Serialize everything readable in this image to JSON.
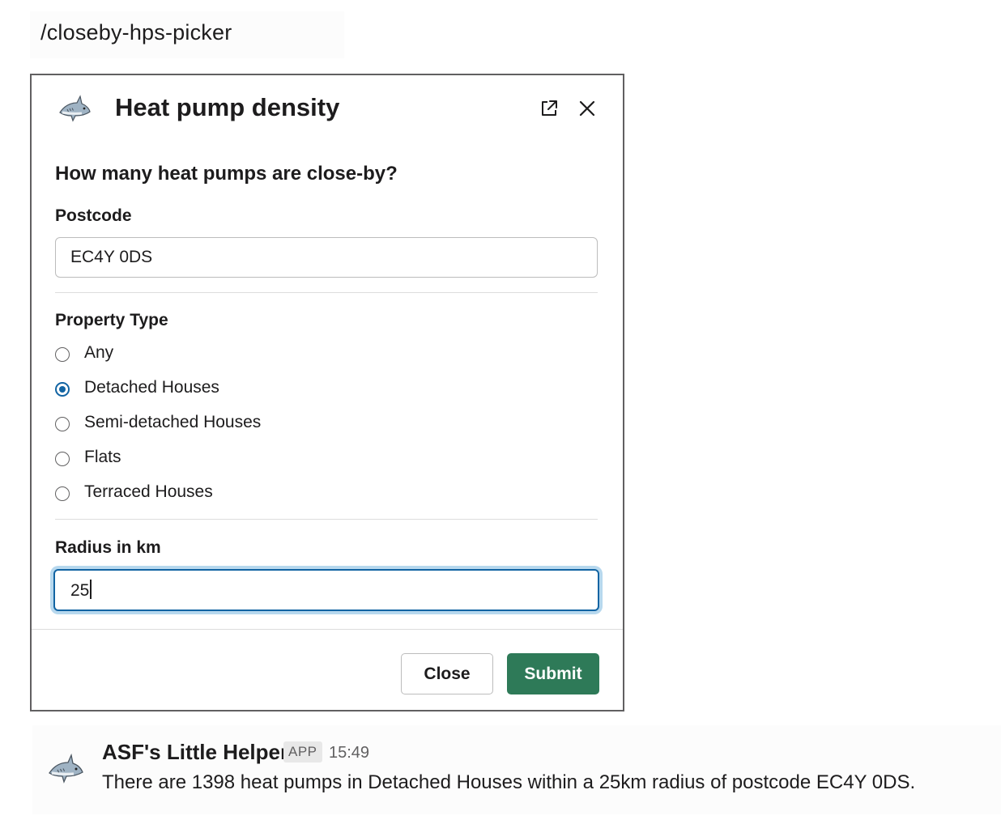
{
  "command": {
    "text": "/closeby-hps-picker"
  },
  "modal": {
    "title": "Heat pump density",
    "app_icon": "shark-icon",
    "header_icons": [
      "external-link-icon",
      "close-icon"
    ],
    "question": "How many heat pumps are close-by?",
    "postcode": {
      "label": "Postcode",
      "value": "EC4Y 0DS"
    },
    "property_type": {
      "label": "Property Type",
      "selected": "Detached Houses",
      "options": [
        "Any",
        "Detached Houses",
        "Semi-detached Houses",
        "Flats",
        "Terraced Houses"
      ]
    },
    "radius": {
      "label": "Radius in km",
      "value": "25"
    },
    "buttons": {
      "close": "Close",
      "submit": "Submit"
    },
    "colors": {
      "submit": "#2e7a58",
      "focus": "#1264a3",
      "focus_ring": "#b7d8ee"
    }
  },
  "message": {
    "author": "ASF's Little Helper",
    "badge": "APP",
    "time": "15:49",
    "text": "There are 1398 heat pumps in Detached Houses within a 25km radius of postcode EC4Y 0DS.",
    "avatar_icon": "shark-icon"
  }
}
